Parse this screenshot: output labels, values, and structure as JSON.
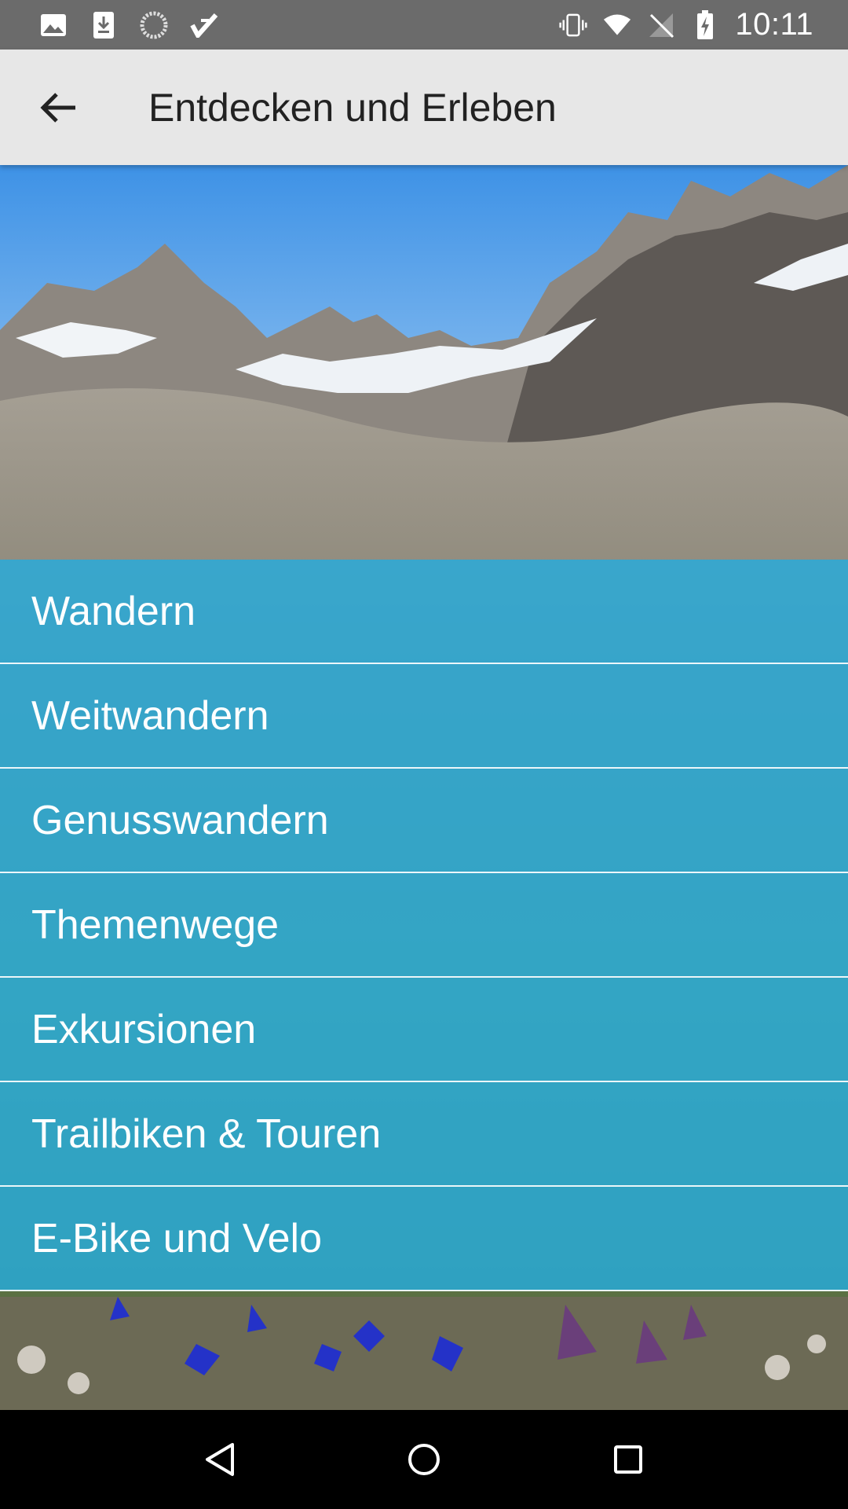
{
  "status_bar": {
    "time": "10:11",
    "left_icons": [
      "image-icon",
      "download-icon",
      "sync-icon",
      "check-icon"
    ],
    "right_icons": [
      "vibrate-icon",
      "wifi-icon",
      "no-signal-icon",
      "battery-charging-icon"
    ]
  },
  "app_bar": {
    "title": "Entdecken und Erleben",
    "back_icon": "arrow-back-icon"
  },
  "menu": {
    "items": [
      {
        "label": "Wandern"
      },
      {
        "label": "Weitwandern"
      },
      {
        "label": "Genusswandern"
      },
      {
        "label": "Themenwege"
      },
      {
        "label": "Exkursionen"
      },
      {
        "label": "Trailbiken & Touren"
      },
      {
        "label": "E-Bike und Velo"
      }
    ],
    "overlay_color": "#26ACDD"
  },
  "nav_bar": {
    "icons": [
      "back-triangle-icon",
      "home-circle-icon",
      "recents-square-icon"
    ]
  }
}
